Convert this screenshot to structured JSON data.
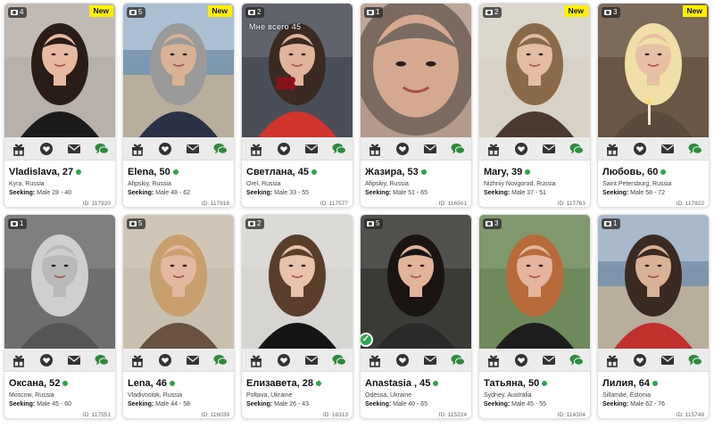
{
  "icons": {
    "gift": "gift-icon",
    "like": "heart-icon",
    "mail": "envelope-icon",
    "chat": "chat-bubble-icon",
    "camera": "camera-icon"
  },
  "colors": {
    "online": "#2ea44f",
    "chat_icon": "#2e8b3c",
    "action_icon": "#333333",
    "new_badge": "#ffee00"
  },
  "seeking_label": "Seeking:",
  "new_label": "New",
  "profiles": [
    {
      "photo_count": "4",
      "new": true,
      "caption": "",
      "verified": false,
      "name": "Vladislava, 27",
      "location": "Kyra, Russia",
      "seeking": "Male 28 - 40",
      "id": "ID: 117920",
      "scene": {
        "bg": "#b8b0aa",
        "hair": "#2a1c16",
        "skin": "#e6b9a0",
        "top": "#1b1b1b"
      }
    },
    {
      "photo_count": "5",
      "new": true,
      "caption": "",
      "verified": false,
      "name": "Elena, 50",
      "location": "Afipskiy, Russia",
      "seeking": "Male 48 - 62",
      "id": "ID: 117918",
      "scene": {
        "bg": "#9fb8cc",
        "hair": "#9a9a9a",
        "skin": "#d9b195",
        "top": "#2a3146"
      }
    },
    {
      "photo_count": "2",
      "new": false,
      "caption": "Мне всего 45",
      "verified": false,
      "name": "Светлана, 45",
      "location": "Orel, Russia",
      "seeking": "Male 33 - 55",
      "id": "ID: 117577",
      "scene": {
        "bg": "#4a4e58",
        "hair": "#3b2a22",
        "skin": "#e0b49a",
        "top": "#d0342c"
      }
    },
    {
      "photo_count": "1",
      "new": false,
      "caption": "",
      "verified": false,
      "name": "Жазира, 53",
      "location": "Afipskiy, Russia",
      "seeking": "Male 51 - 65",
      "id": "ID: 116501",
      "scene": {
        "bg": "#b49a8a",
        "hair": "#7a6a60",
        "skin": "#d5a98f",
        "top": "#8e7a6e"
      }
    },
    {
      "photo_count": "2",
      "new": true,
      "caption": "",
      "verified": false,
      "name": "Mary, 39",
      "location": "Nizhniy Novgorod, Russia",
      "seeking": "Male 37 - 51",
      "id": "ID: 117763",
      "scene": {
        "bg": "#d8d2c6",
        "hair": "#8a6a48",
        "skin": "#e4bca2",
        "top": "#4a3a30"
      }
    },
    {
      "photo_count": "3",
      "new": true,
      "caption": "",
      "verified": false,
      "name": "Любовь, 60",
      "location": "Saint Petersburg, Russia",
      "seeking": "Male 58 - 72",
      "id": "ID: 117922",
      "scene": {
        "bg": "#6a5644",
        "hair": "#f0dfa8",
        "skin": "#e8c0a6",
        "top": "#5a4a3c"
      }
    },
    {
      "photo_count": "1",
      "new": false,
      "caption": "",
      "verified": false,
      "name": "Оксана, 52",
      "location": "Moscow, Russia",
      "seeking": "Male 45 - 60",
      "id": "ID: 117551",
      "scene": {
        "bg": "#6e6e6e",
        "hair": "#cfcfcf",
        "skin": "#b9b9b9",
        "top": "#555555"
      }
    },
    {
      "photo_count": "5",
      "new": false,
      "caption": "",
      "verified": false,
      "name": "Lena, 46",
      "location": "Vladivostok, Russia",
      "seeking": "Male 44 - 58",
      "id": "ID: 116039",
      "scene": {
        "bg": "#c9bfae",
        "hair": "#c8a070",
        "skin": "#e2b9a0",
        "top": "#6a5240"
      }
    },
    {
      "photo_count": "2",
      "new": false,
      "caption": "",
      "verified": false,
      "name": "Елизавета, 28",
      "location": "Poltava, Ukraine",
      "seeking": "Male 26 - 43",
      "id": "ID: 16313",
      "scene": {
        "bg": "#d7d5d2",
        "hair": "#5a3e2c",
        "skin": "#e8c2aa",
        "top": "#141414"
      }
    },
    {
      "photo_count": "5",
      "new": false,
      "caption": "",
      "verified": true,
      "name": "Anastasia , 45",
      "location": "Odessa, Ukraine",
      "seeking": "Male 40 - 65",
      "id": "ID: 115224",
      "scene": {
        "bg": "#3a3a36",
        "hair": "#1a1412",
        "skin": "#e2b49a",
        "top": "#2a2a2a"
      }
    },
    {
      "photo_count": "3",
      "new": false,
      "caption": "",
      "verified": false,
      "name": "Татьяна, 50",
      "location": "Sydney, Australia",
      "seeking": "Male 45 - 55",
      "id": "ID: 114304",
      "scene": {
        "bg": "#6e8a5a",
        "hair": "#b86a3a",
        "skin": "#e4b49c",
        "top": "#1e1e1e"
      }
    },
    {
      "photo_count": "1",
      "new": false,
      "caption": "",
      "verified": false,
      "name": "Лилия, 64",
      "location": "Sillamäe, Estonia",
      "seeking": "Male 62 - 76",
      "id": "ID: 115749",
      "scene": {
        "bg": "#9eb0c4",
        "hair": "#3a2a22",
        "skin": "#d9b195",
        "top": "#c0302c"
      }
    }
  ]
}
